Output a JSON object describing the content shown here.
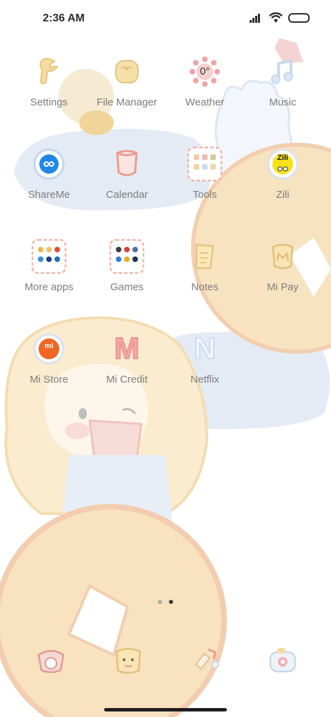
{
  "status": {
    "time": "2:36 AM"
  },
  "apps": [
    {
      "label": "Settings"
    },
    {
      "label": "File Manager"
    },
    {
      "label": "Weather",
      "temp": "0°"
    },
    {
      "label": "Music"
    },
    {
      "label": "ShareMe"
    },
    {
      "label": "Calendar"
    },
    {
      "label": "Tools"
    },
    {
      "label": "Zili",
      "badge": "Zili"
    },
    {
      "label": "More apps"
    },
    {
      "label": "Games"
    },
    {
      "label": "Notes"
    },
    {
      "label": "Mi Pay"
    },
    {
      "label": "Mi Store",
      "badge": "mi"
    },
    {
      "label": "Mi Credit",
      "badge": "M"
    },
    {
      "label": "Netflix",
      "badge": "N"
    }
  ],
  "pager": {
    "active_page": 2,
    "pages": 2
  },
  "dock": [
    {
      "name": "phone"
    },
    {
      "name": "messages"
    },
    {
      "name": "browser"
    },
    {
      "name": "camera"
    }
  ],
  "colors": {
    "accent_peach": "#f6d7a6",
    "accent_blue": "#e3e9f3",
    "pink": "#f0a8a8"
  }
}
